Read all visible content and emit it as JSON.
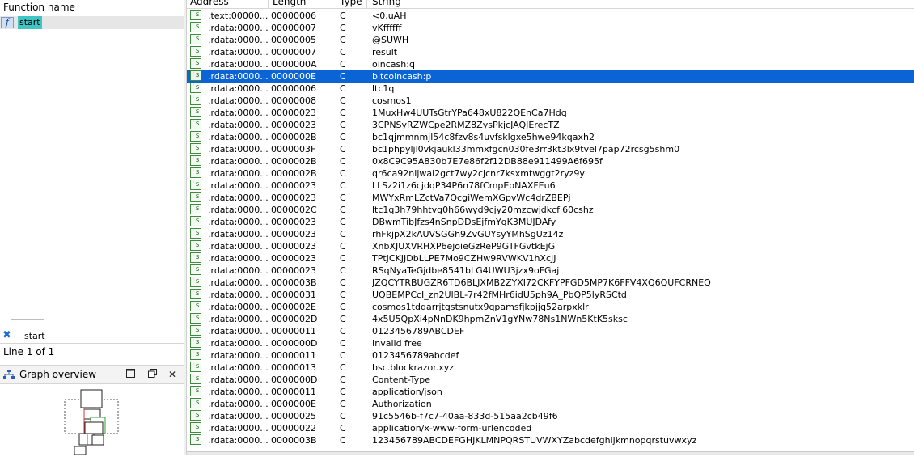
{
  "functions": {
    "header": "Function name",
    "items": [
      {
        "icon": "function-icon",
        "icon_glyph": "f",
        "name": "start"
      }
    ]
  },
  "filter": {
    "clear_icon": "close-icon",
    "value": "start"
  },
  "status": {
    "line_info": "Line 1 of 1"
  },
  "graph_overview": {
    "title": "Graph overview",
    "icon": "graph-overview-icon",
    "buttons": {
      "minimize": "🗖",
      "restore": "🗗",
      "close": "✕"
    }
  },
  "strings_table": {
    "headers": {
      "address": "Address",
      "length": "Length",
      "type": "Type",
      "string": "String"
    },
    "selected_index": 5,
    "rows": [
      {
        "address": ".text:00000...",
        "length": "00000006",
        "type": "C",
        "string": "<0.uAH"
      },
      {
        "address": ".rdata:0000...",
        "length": "00000007",
        "type": "C",
        "string": "vKffffff"
      },
      {
        "address": ".rdata:0000...",
        "length": "00000005",
        "type": "C",
        "string": "@SUWH"
      },
      {
        "address": ".rdata:0000...",
        "length": "00000007",
        "type": "C",
        "string": "result"
      },
      {
        "address": ".rdata:0000...",
        "length": "0000000A",
        "type": "C",
        "string": "oincash:q"
      },
      {
        "address": ".rdata:0000...",
        "length": "0000000E",
        "type": "C",
        "string": "bitcoincash:p"
      },
      {
        "address": ".rdata:0000...",
        "length": "00000006",
        "type": "C",
        "string": "ltc1q"
      },
      {
        "address": ".rdata:0000...",
        "length": "00000008",
        "type": "C",
        "string": "cosmos1"
      },
      {
        "address": ".rdata:0000...",
        "length": "00000023",
        "type": "C",
        "string": "1MuxHw4UUTsGtrYPa648xU822QEnCa7Hdq"
      },
      {
        "address": ".rdata:0000...",
        "length": "00000023",
        "type": "C",
        "string": "3CPNSyRZWCpe2RMZ8ZysPkjcJAQJErecTZ"
      },
      {
        "address": ".rdata:0000...",
        "length": "0000002B",
        "type": "C",
        "string": "bc1qjmmnmjl54c8fzv8s4uvfsklgxe5hwe94kqaxh2"
      },
      {
        "address": ".rdata:0000...",
        "length": "0000003F",
        "type": "C",
        "string": "bc1phpyljl0vkjaukl33mmxfgcn030fe3rr3kt3lx9tvel7pap72rcsg5shm0"
      },
      {
        "address": ".rdata:0000...",
        "length": "0000002B",
        "type": "C",
        "string": "0x8C9C95A830b7E7e86f2f12DB88e911499A6f695f"
      },
      {
        "address": ".rdata:0000...",
        "length": "0000002B",
        "type": "C",
        "string": "qr6ca92nljwal2gct7wy2cjcnr7ksxmtwggt2ryz9y"
      },
      {
        "address": ".rdata:0000...",
        "length": "00000023",
        "type": "C",
        "string": "LLSz2i1z6cjdqP34P6n78fCmpEoNAXFEu6"
      },
      {
        "address": ".rdata:0000...",
        "length": "00000023",
        "type": "C",
        "string": "MWYxRmLZctVa7QcgiWemXGpvWc4drZBEPj"
      },
      {
        "address": ".rdata:0000...",
        "length": "0000002C",
        "type": "C",
        "string": "ltc1q3h79hhtvg0h66wyd9cjy20mzcwjdkcfj60cshz"
      },
      {
        "address": ".rdata:0000...",
        "length": "00000023",
        "type": "C",
        "string": "DBwmTibJfzs4nSnpDDsEjfmYqK3MUJDAfy"
      },
      {
        "address": ".rdata:0000...",
        "length": "00000023",
        "type": "C",
        "string": "rhFkjpX2kAUVSGGh9ZvGUYsyYMhSgUz14z"
      },
      {
        "address": ".rdata:0000...",
        "length": "00000023",
        "type": "C",
        "string": "XnbXJUXVRHXP6ejoieGzReP9GTFGvtkEjG"
      },
      {
        "address": ".rdata:0000...",
        "length": "00000023",
        "type": "C",
        "string": "TPtJCKJJDbLLPE7Mo9CZHw9RVWKV1hXcJJ"
      },
      {
        "address": ".rdata:0000...",
        "length": "00000023",
        "type": "C",
        "string": "RSqNyaTeGjdbe8541bLG4UWU3jzx9oFGaj"
      },
      {
        "address": ".rdata:0000...",
        "length": "0000003B",
        "type": "C",
        "string": "JZQCYTRBUGZR6TD6BLJXMB2ZYXI72CKFYPFGD5MP7K6FFV4XQ6QUFCRNEQ"
      },
      {
        "address": ".rdata:0000...",
        "length": "00000031",
        "type": "C",
        "string": "UQBEMPCcI_zn2UlBL-7r42fMHr6idU5ph9A_PbQP5lyRSCtd"
      },
      {
        "address": ".rdata:0000...",
        "length": "0000002E",
        "type": "C",
        "string": "cosmos1tddarrjtgstsnutx9qpamsfjkpjjq52arpxklr"
      },
      {
        "address": ".rdata:0000...",
        "length": "0000002D",
        "type": "C",
        "string": "4x5U5QpXi4pNnDK9hpmZnV1gYNw78Ns1NWn5KtK5sksc"
      },
      {
        "address": ".rdata:0000...",
        "length": "00000011",
        "type": "C",
        "string": "0123456789ABCDEF"
      },
      {
        "address": ".rdata:0000...",
        "length": "0000000D",
        "type": "C",
        "string": "Invalid free"
      },
      {
        "address": ".rdata:0000...",
        "length": "00000011",
        "type": "C",
        "string": "0123456789abcdef"
      },
      {
        "address": ".rdata:0000...",
        "length": "00000013",
        "type": "C",
        "string": "bsc.blockrazor.xyz"
      },
      {
        "address": ".rdata:0000...",
        "length": "0000000D",
        "type": "C",
        "string": "Content-Type"
      },
      {
        "address": ".rdata:0000...",
        "length": "00000011",
        "type": "C",
        "string": "application/json"
      },
      {
        "address": ".rdata:0000...",
        "length": "0000000E",
        "type": "C",
        "string": "Authorization"
      },
      {
        "address": ".rdata:0000...",
        "length": "00000025",
        "type": "C",
        "string": "91c5546b-f7c7-40aa-833d-515aa2cb49f6"
      },
      {
        "address": ".rdata:0000...",
        "length": "00000022",
        "type": "C",
        "string": "application/x-www-form-urlencoded"
      },
      {
        "address": ".rdata:0000...",
        "length": "0000003B",
        "type": "C",
        "string": "123456789ABCDEFGHJKLMNPQRSTUVWXYZabcdefghijkmnopqrstuvwxyz"
      }
    ]
  }
}
